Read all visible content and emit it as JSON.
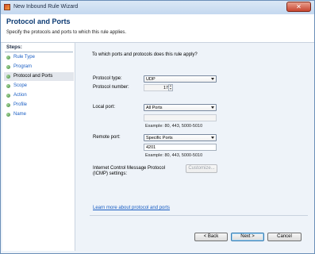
{
  "window": {
    "title": "New Inbound Rule Wizard",
    "close_glyph": "✕"
  },
  "header": {
    "title": "Protocol and Ports",
    "description": "Specify the protocols and ports to which this rule applies."
  },
  "steps": {
    "heading": "Steps:",
    "items": [
      {
        "label": "Rule Type"
      },
      {
        "label": "Program"
      },
      {
        "label": "Protocol and Ports"
      },
      {
        "label": "Scope"
      },
      {
        "label": "Action"
      },
      {
        "label": "Profile"
      },
      {
        "label": "Name"
      }
    ],
    "active_index": 2
  },
  "form": {
    "question": "To which ports and protocols does this rule apply?",
    "protocol_type": {
      "label": "Protocol type:",
      "value": "UDP"
    },
    "protocol_number": {
      "label": "Protocol number:",
      "value": "17"
    },
    "local_port": {
      "label": "Local port:",
      "value": "All Ports",
      "input_value": "",
      "example": "Example: 80, 443, 5000-5010"
    },
    "remote_port": {
      "label": "Remote port:",
      "value": "Specific Ports",
      "input_value": "4201",
      "example": "Example: 80, 443, 5000-5010"
    },
    "icmp": {
      "label_line1": "Internet Control Message Protocol",
      "label_line2": "(ICMP) settings:",
      "button": "Customize..."
    },
    "learn_more": "Learn more about protocol and ports"
  },
  "buttons": {
    "back": "< Back",
    "next": "Next >",
    "cancel": "Cancel"
  },
  "colors": {
    "link": "#1a5ec4",
    "header_title": "#0b3a73",
    "close_button": "#c7452f"
  }
}
